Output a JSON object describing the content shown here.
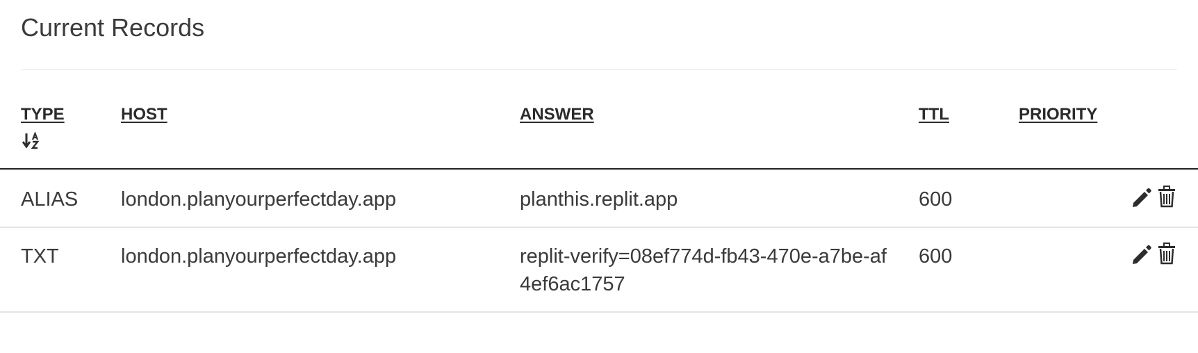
{
  "page": {
    "title": "Current Records"
  },
  "table": {
    "columns": {
      "type": "TYPE",
      "host": "HOST",
      "answer": "ANSWER",
      "ttl": "TTL",
      "priority": "PRIORITY"
    },
    "sort_icon": "sort-alpha-down-icon",
    "rows": [
      {
        "type": "ALIAS",
        "host": "london.planyourperfectday.app",
        "answer": "planthis.replit.app",
        "ttl": "600",
        "priority": ""
      },
      {
        "type": "TXT",
        "host": "london.planyourperfectday.app",
        "answer": "replit-verify=08ef774d-fb43-470e-a7be-af4ef6ac1757",
        "ttl": "600",
        "priority": ""
      }
    ],
    "row_actions": [
      "pencil-icon",
      "trash-icon"
    ]
  },
  "colors": {
    "text": "#3a3a3a",
    "header_rule": "#222222",
    "row_rule": "#e4e4e4",
    "icon": "#2d2d2d"
  }
}
